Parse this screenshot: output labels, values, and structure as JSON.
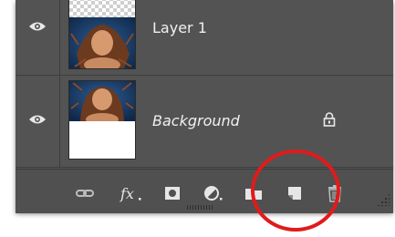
{
  "layers_panel": {
    "layers": [
      {
        "name": "Layer 1",
        "visible": true,
        "locked": false,
        "icons": {
          "visibility": "eye-icon",
          "thumbnail": "layer-thumbnail-transparent"
        }
      },
      {
        "name": "Background",
        "visible": true,
        "locked": true,
        "icons": {
          "visibility": "eye-icon",
          "lock": "lock-icon"
        }
      }
    ],
    "bottom_bar_icons": [
      "link-layers-icon",
      "fx-icon",
      "layer-mask-icon",
      "adjustment-layer-icon",
      "new-group-icon",
      "new-layer-icon",
      "trash-icon"
    ],
    "highlighted_icon": "new-layer-icon",
    "colors": {
      "panel": "#535353",
      "annotation": "#e01b1b"
    }
  }
}
